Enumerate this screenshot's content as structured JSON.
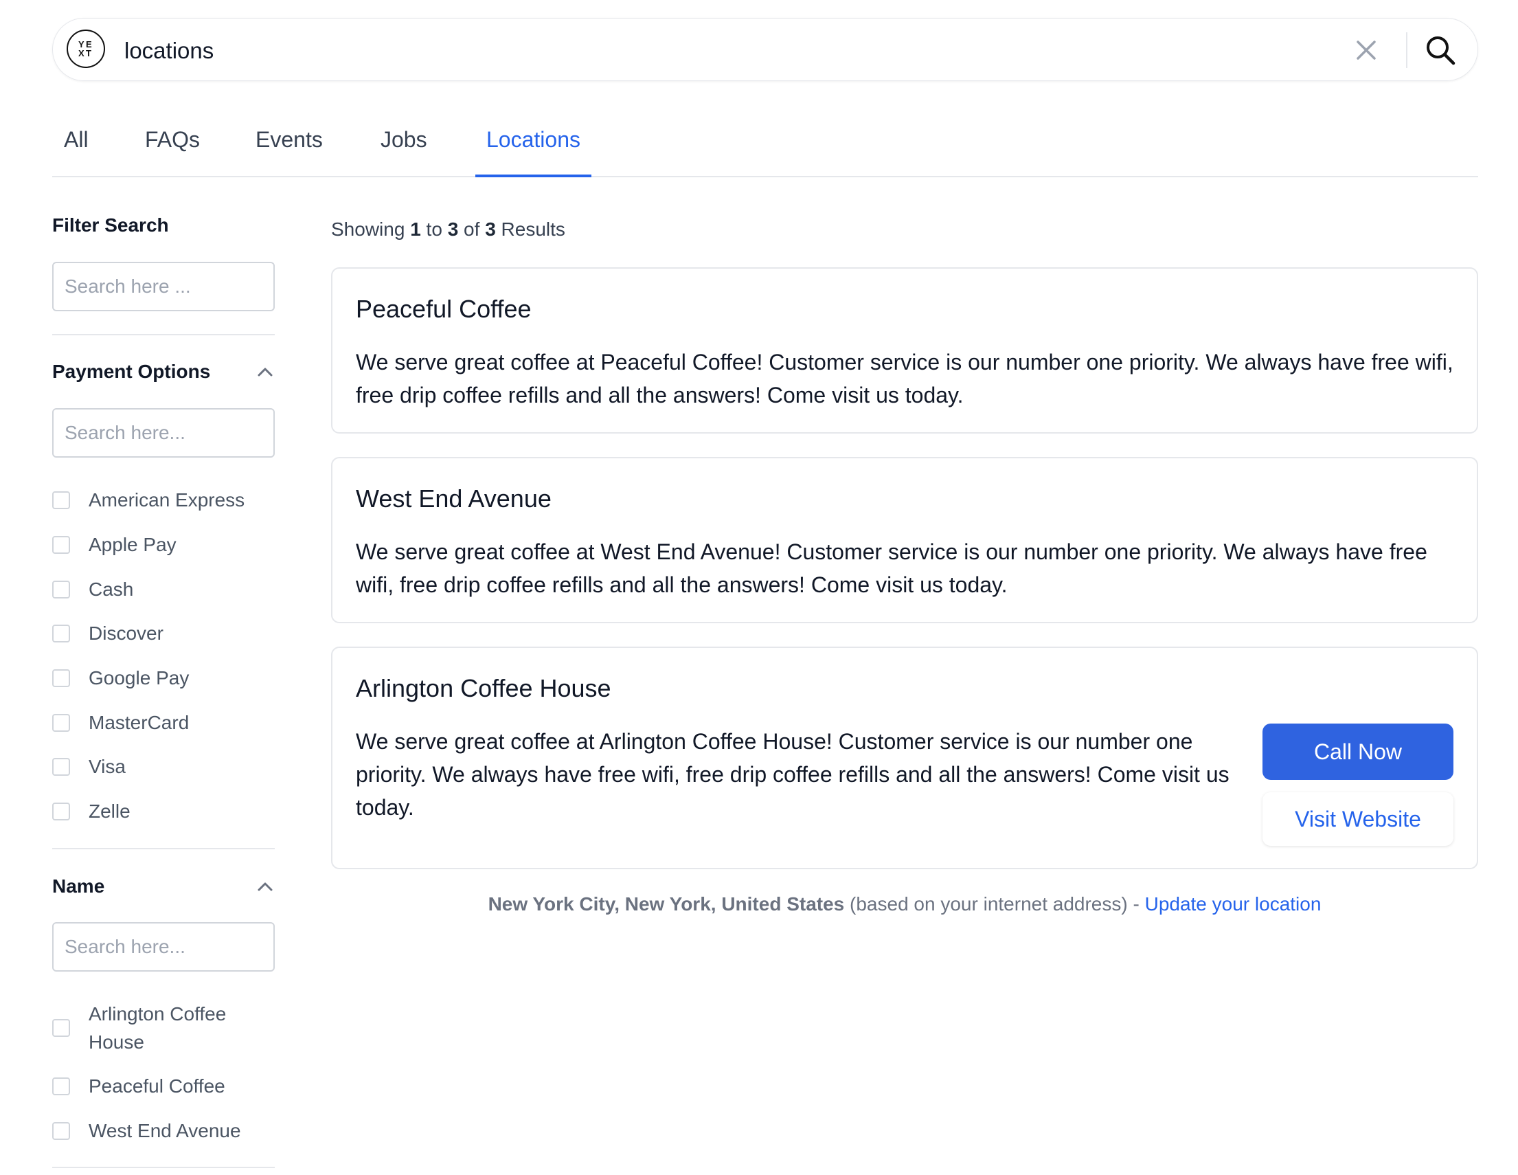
{
  "search": {
    "query": "locations",
    "logo_text": "YEXT"
  },
  "tabs": [
    {
      "label": "All",
      "active": false
    },
    {
      "label": "FAQs",
      "active": false
    },
    {
      "label": "Events",
      "active": false
    },
    {
      "label": "Jobs",
      "active": false
    },
    {
      "label": "Locations",
      "active": true
    }
  ],
  "filters": {
    "title": "Filter Search",
    "search_placeholder": "Search here ...",
    "facets": [
      {
        "title": "Payment Options",
        "placeholder": "Search here...",
        "options": [
          "American Express",
          "Apple Pay",
          "Cash",
          "Discover",
          "Google Pay",
          "MasterCard",
          "Visa",
          "Zelle"
        ]
      },
      {
        "title": "Name",
        "placeholder": "Search here...",
        "options": [
          "Arlington Coffee House",
          "Peaceful Coffee",
          "West End Avenue"
        ]
      }
    ]
  },
  "results": {
    "count_prefix": "Showing",
    "start": "1",
    "to_word": "to",
    "end": "3",
    "of_word": "of",
    "total": "3",
    "suffix": "Results",
    "items": [
      {
        "title": "Peaceful Coffee",
        "description": "We serve great coffee at Peaceful Coffee! Customer service is our number one priority. We always have free wifi, free drip coffee refills and all the answers! Come visit us today."
      },
      {
        "title": "West End Avenue",
        "description": "We serve great coffee at West End Avenue! Customer service is our number one priority. We always have free wifi, free drip coffee refills and all the answers! Come visit us today."
      },
      {
        "title": "Arlington Coffee House",
        "description": "We serve great coffee at Arlington Coffee House! Customer service is our number one priority. We always have free wifi, free drip coffee refills and all the answers! Come visit us today.",
        "cta_primary": "Call Now",
        "cta_secondary": "Visit Website"
      }
    ]
  },
  "location": {
    "place": "New York City, New York, United States",
    "basis": "(based on your internet address) -",
    "update_link": "Update your location"
  },
  "colors": {
    "accent": "#2563eb",
    "border": "#e5e7eb"
  }
}
